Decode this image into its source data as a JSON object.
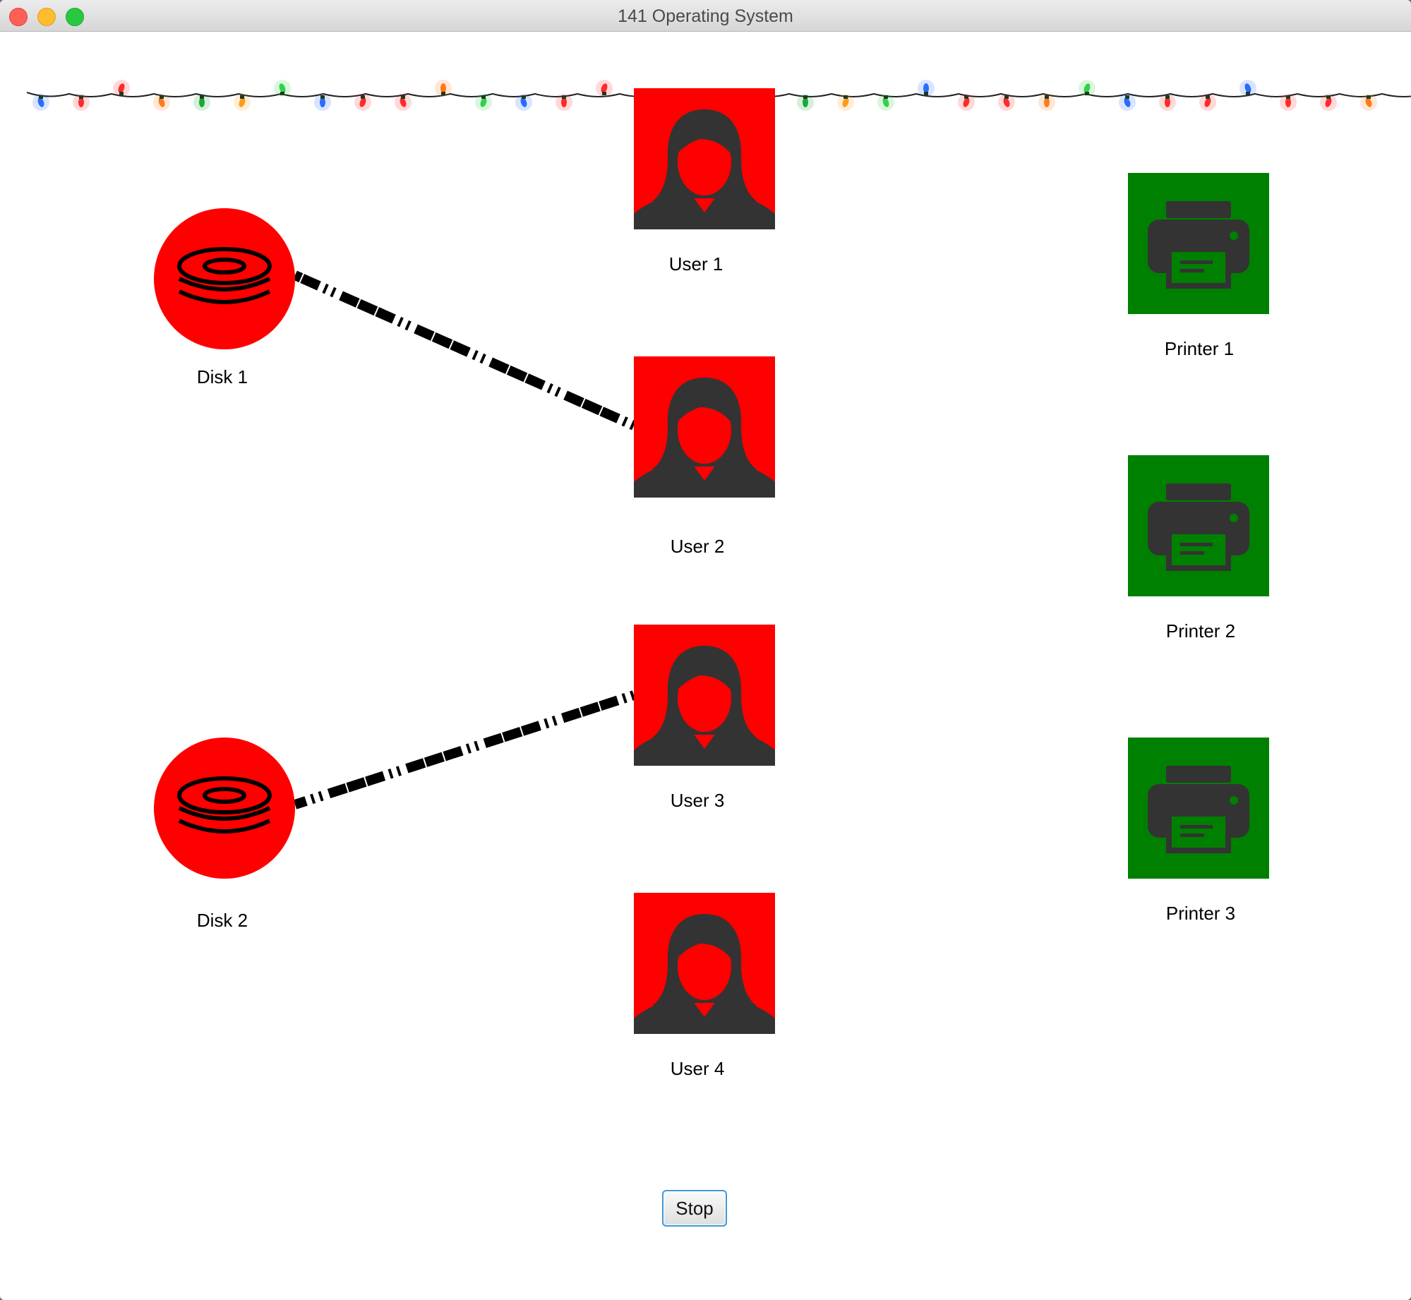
{
  "window": {
    "title": "141 Operating System"
  },
  "colors": {
    "busy": "#ff0000",
    "free": "#008000",
    "icon": "#333333"
  },
  "users": [
    {
      "label": "User 1",
      "status": "busy",
      "icon": "user-icon"
    },
    {
      "label": "User 2",
      "status": "busy",
      "icon": "user-icon"
    },
    {
      "label": "User 3",
      "status": "busy",
      "icon": "user-icon"
    },
    {
      "label": "User 4",
      "status": "busy",
      "icon": "user-icon"
    }
  ],
  "disks": [
    {
      "label": "Disk 1",
      "status": "busy",
      "icon": "disk-icon"
    },
    {
      "label": "Disk 2",
      "status": "busy",
      "icon": "disk-icon"
    }
  ],
  "printers": [
    {
      "label": "Printer 1",
      "status": "free",
      "icon": "printer-icon"
    },
    {
      "label": "Printer 2",
      "status": "free",
      "icon": "printer-icon"
    },
    {
      "label": "Printer 3",
      "status": "free",
      "icon": "printer-icon"
    }
  ],
  "connections": [
    {
      "from": "User 2",
      "to": "Disk 1"
    },
    {
      "from": "User 3",
      "to": "Disk 2"
    }
  ],
  "controls": {
    "stop_label": "Stop"
  },
  "decoration": {
    "garland": "christmas-lights-garland"
  }
}
